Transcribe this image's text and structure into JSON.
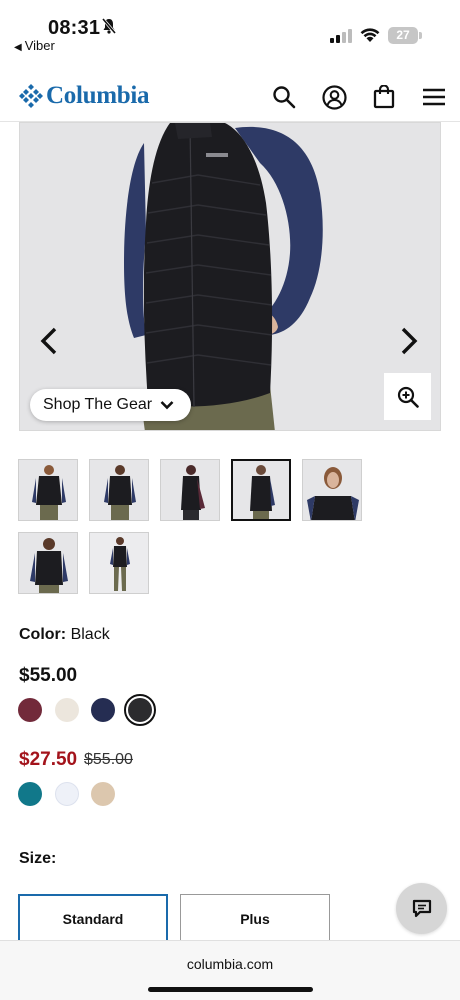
{
  "status_bar": {
    "time": "08:31",
    "back_app": "Viber",
    "battery": "27"
  },
  "header": {
    "brand": "Columbia",
    "brand_color": "#1a6aab",
    "icons": [
      "search-icon",
      "account-icon",
      "bag-icon",
      "menu-icon"
    ]
  },
  "gallery": {
    "shop_the_gear_label": "Shop The Gear",
    "thumbnail_count": 7,
    "selected_thumbnail": 4
  },
  "product": {
    "color_label": "Color:",
    "color_value": "Black",
    "regular_price": "$55.00",
    "regular_swatches": [
      {
        "name": "burgundy",
        "hex": "#722a3a"
      },
      {
        "name": "cream",
        "hex": "#ece6dd"
      },
      {
        "name": "navy",
        "hex": "#252d52"
      },
      {
        "name": "black",
        "hex": "#2b2b2e",
        "selected": true
      }
    ],
    "sale_price": "$27.50",
    "sale_original_price": "$55.00",
    "sale_color": "#a3131b",
    "sale_swatches": [
      {
        "name": "teal",
        "hex": "#11788a"
      },
      {
        "name": "white",
        "hex": "#eef1f8"
      },
      {
        "name": "tan",
        "hex": "#dcc7ae"
      }
    ]
  },
  "size": {
    "label": "Size:",
    "options": [
      "Standard",
      "Plus"
    ],
    "selected": "Standard"
  },
  "browser": {
    "url": "columbia.com"
  }
}
